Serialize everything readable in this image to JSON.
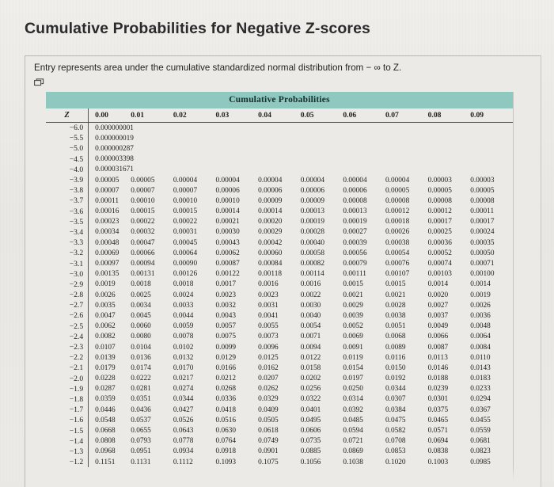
{
  "page_title": "Cumulative Probabilities for Negative Z-scores",
  "card": {
    "caption": "Entry represents area under the cumulative standardized normal distribution from  − ∞ to Z.",
    "copy_icon": "copy-icon"
  },
  "chart_data": {
    "type": "table",
    "title": "Cumulative Probabilities",
    "xlabel": "",
    "ylabel": "",
    "row_header": "Z",
    "categories": [
      "0.00",
      "0.01",
      "0.02",
      "0.03",
      "0.04",
      "0.05",
      "0.06",
      "0.07",
      "0.08",
      "0.09"
    ],
    "rows": [
      {
        "z": "−6.0",
        "values": [
          "0.000000001",
          "",
          "",
          "",
          "",
          "",
          "",
          "",
          "",
          ""
        ]
      },
      {
        "z": "−5.5",
        "values": [
          "0.000000019",
          "",
          "",
          "",
          "",
          "",
          "",
          "",
          "",
          ""
        ]
      },
      {
        "z": "−5.0",
        "values": [
          "0.000000287",
          "",
          "",
          "",
          "",
          "",
          "",
          "",
          "",
          ""
        ]
      },
      {
        "z": "−4.5",
        "values": [
          "0.000003398",
          "",
          "",
          "",
          "",
          "",
          "",
          "",
          "",
          ""
        ]
      },
      {
        "z": "−4.0",
        "values": [
          "0.000031671",
          "",
          "",
          "",
          "",
          "",
          "",
          "",
          "",
          ""
        ]
      },
      {
        "z": "−3.9",
        "values": [
          "0.00005",
          "0.00005",
          "0.00004",
          "0.00004",
          "0.00004",
          "0.00004",
          "0.00004",
          "0.00004",
          "0.00003",
          "0.00003"
        ]
      },
      {
        "z": "−3.8",
        "values": [
          "0.00007",
          "0.00007",
          "0.00007",
          "0.00006",
          "0.00006",
          "0.00006",
          "0.00006",
          "0.00005",
          "0.00005",
          "0.00005"
        ]
      },
      {
        "z": "−3.7",
        "values": [
          "0.00011",
          "0.00010",
          "0.00010",
          "0.00010",
          "0.00009",
          "0.00009",
          "0.00008",
          "0.00008",
          "0.00008",
          "0.00008"
        ]
      },
      {
        "z": "−3.6",
        "values": [
          "0.00016",
          "0.00015",
          "0.00015",
          "0.00014",
          "0.00014",
          "0.00013",
          "0.00013",
          "0.00012",
          "0.00012",
          "0.00011"
        ]
      },
      {
        "z": "−3.5",
        "values": [
          "0.00023",
          "0.00022",
          "0.00022",
          "0.00021",
          "0.00020",
          "0.00019",
          "0.00019",
          "0.00018",
          "0.00017",
          "0.00017"
        ]
      },
      {
        "z": "−3.4",
        "values": [
          "0.00034",
          "0.00032",
          "0.00031",
          "0.00030",
          "0.00029",
          "0.00028",
          "0.00027",
          "0.00026",
          "0.00025",
          "0.00024"
        ]
      },
      {
        "z": "−3.3",
        "values": [
          "0.00048",
          "0.00047",
          "0.00045",
          "0.00043",
          "0.00042",
          "0.00040",
          "0.00039",
          "0.00038",
          "0.00036",
          "0.00035"
        ]
      },
      {
        "z": "−3.2",
        "values": [
          "0.00069",
          "0.00066",
          "0.00064",
          "0.00062",
          "0.00060",
          "0.00058",
          "0.00056",
          "0.00054",
          "0.00052",
          "0.00050"
        ]
      },
      {
        "z": "−3.1",
        "values": [
          "0.00097",
          "0.00094",
          "0.00090",
          "0.00087",
          "0.00084",
          "0.00082",
          "0.00079",
          "0.00076",
          "0.00074",
          "0.00071"
        ]
      },
      {
        "z": "−3.0",
        "values": [
          "0.00135",
          "0.00131",
          "0.00126",
          "0.00122",
          "0.00118",
          "0.00114",
          "0.00111",
          "0.00107",
          "0.00103",
          "0.00100"
        ]
      },
      {
        "z": "−2.9",
        "values": [
          "0.0019",
          "0.0018",
          "0.0018",
          "0.0017",
          "0.0016",
          "0.0016",
          "0.0015",
          "0.0015",
          "0.0014",
          "0.0014"
        ]
      },
      {
        "z": "−2.8",
        "values": [
          "0.0026",
          "0.0025",
          "0.0024",
          "0.0023",
          "0.0023",
          "0.0022",
          "0.0021",
          "0.0021",
          "0.0020",
          "0.0019"
        ]
      },
      {
        "z": "−2.7",
        "values": [
          "0.0035",
          "0.0034",
          "0.0033",
          "0.0032",
          "0.0031",
          "0.0030",
          "0.0029",
          "0.0028",
          "0.0027",
          "0.0026"
        ]
      },
      {
        "z": "−2.6",
        "values": [
          "0.0047",
          "0.0045",
          "0.0044",
          "0.0043",
          "0.0041",
          "0.0040",
          "0.0039",
          "0.0038",
          "0.0037",
          "0.0036"
        ]
      },
      {
        "z": "−2.5",
        "values": [
          "0.0062",
          "0.0060",
          "0.0059",
          "0.0057",
          "0.0055",
          "0.0054",
          "0.0052",
          "0.0051",
          "0.0049",
          "0.0048"
        ]
      },
      {
        "z": "−2.4",
        "values": [
          "0.0082",
          "0.0080",
          "0.0078",
          "0.0075",
          "0.0073",
          "0.0071",
          "0.0069",
          "0.0068",
          "0.0066",
          "0.0064"
        ]
      },
      {
        "z": "−2.3",
        "values": [
          "0.0107",
          "0.0104",
          "0.0102",
          "0.0099",
          "0.0096",
          "0.0094",
          "0.0091",
          "0.0089",
          "0.0087",
          "0.0084"
        ]
      },
      {
        "z": "−2.2",
        "values": [
          "0.0139",
          "0.0136",
          "0.0132",
          "0.0129",
          "0.0125",
          "0.0122",
          "0.0119",
          "0.0116",
          "0.0113",
          "0.0110"
        ]
      },
      {
        "z": "−2.1",
        "values": [
          "0.0179",
          "0.0174",
          "0.0170",
          "0.0166",
          "0.0162",
          "0.0158",
          "0.0154",
          "0.0150",
          "0.0146",
          "0.0143"
        ]
      },
      {
        "z": "−2.0",
        "values": [
          "0.0228",
          "0.0222",
          "0.0217",
          "0.0212",
          "0.0207",
          "0.0202",
          "0.0197",
          "0.0192",
          "0.0188",
          "0.0183"
        ]
      },
      {
        "z": "−1.9",
        "values": [
          "0.0287",
          "0.0281",
          "0.0274",
          "0.0268",
          "0.0262",
          "0.0256",
          "0.0250",
          "0.0344",
          "0.0239",
          "0.0233"
        ]
      },
      {
        "z": "−1.8",
        "values": [
          "0.0359",
          "0.0351",
          "0.0344",
          "0.0336",
          "0.0329",
          "0.0322",
          "0.0314",
          "0.0307",
          "0.0301",
          "0.0294"
        ]
      },
      {
        "z": "−1.7",
        "values": [
          "0.0446",
          "0.0436",
          "0.0427",
          "0.0418",
          "0.0409",
          "0.0401",
          "0.0392",
          "0.0384",
          "0.0375",
          "0.0367"
        ]
      },
      {
        "z": "−1.6",
        "values": [
          "0.0548",
          "0.0537",
          "0.0526",
          "0.0516",
          "0.0505",
          "0.0495",
          "0.0485",
          "0.0475",
          "0.0465",
          "0.0455"
        ]
      },
      {
        "z": "−1.5",
        "values": [
          "0.0668",
          "0.0655",
          "0.0643",
          "0.0630",
          "0.0618",
          "0.0606",
          "0.0594",
          "0.0582",
          "0.0571",
          "0.0559"
        ]
      },
      {
        "z": "−1.4",
        "values": [
          "0.0808",
          "0.0793",
          "0.0778",
          "0.0764",
          "0.0749",
          "0.0735",
          "0.0721",
          "0.0708",
          "0.0694",
          "0.0681"
        ]
      },
      {
        "z": "−1.3",
        "values": [
          "0.0968",
          "0.0951",
          "0.0934",
          "0.0918",
          "0.0901",
          "0.0885",
          "0.0869",
          "0.0853",
          "0.0838",
          "0.0823"
        ]
      },
      {
        "z": "−1.2",
        "values": [
          "0.1151",
          "0.1131",
          "0.1112",
          "0.1093",
          "0.1075",
          "0.1056",
          "0.1038",
          "0.1020",
          "0.1003",
          "0.0985"
        ]
      }
    ],
    "grid": false,
    "legend": "none"
  },
  "colors": {
    "banner_teal": "#8ec8bf",
    "page_background": "#e9e8e4",
    "card_background": "#eceae6",
    "text": "#1d1d1d"
  }
}
